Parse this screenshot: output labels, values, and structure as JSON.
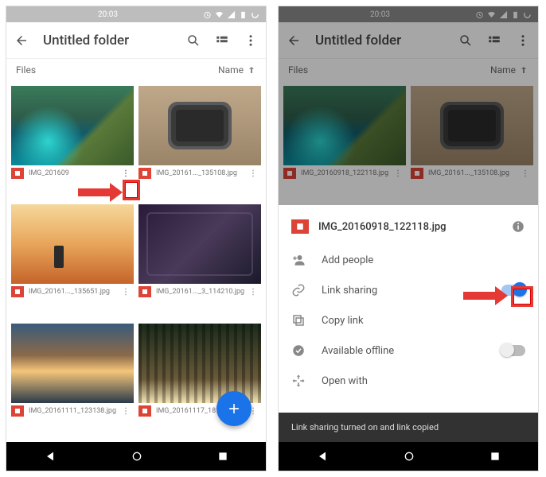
{
  "status": {
    "time": "20:03"
  },
  "appbar": {
    "title": "Untitled folder"
  },
  "sort": {
    "left": "Files",
    "right": "Name"
  },
  "files": [
    {
      "name": "IMG_201609"
    },
    {
      "name": "IMG_20161..._135108.jpg"
    },
    {
      "name": "IMG_20161..._135651.jpg"
    },
    {
      "name": "IMG_20161..._3_114210.jpg"
    },
    {
      "name": "IMG_20161111_123138.jpg"
    },
    {
      "name": "IMG_20161117_181336.jpg"
    }
  ],
  "files_alt": [
    {
      "name": "IMG_20160918_122118.jpg"
    },
    {
      "name": "IMG_20161..._135108.jpg"
    }
  ],
  "sheet": {
    "filename": "IMG_20160918_122118.jpg",
    "rows": {
      "add_people": "Add people",
      "link_sharing": "Link sharing",
      "copy_link": "Copy link",
      "available_offline": "Available offline",
      "open_with": "Open with"
    }
  },
  "toast": "Link sharing turned on and link copied"
}
